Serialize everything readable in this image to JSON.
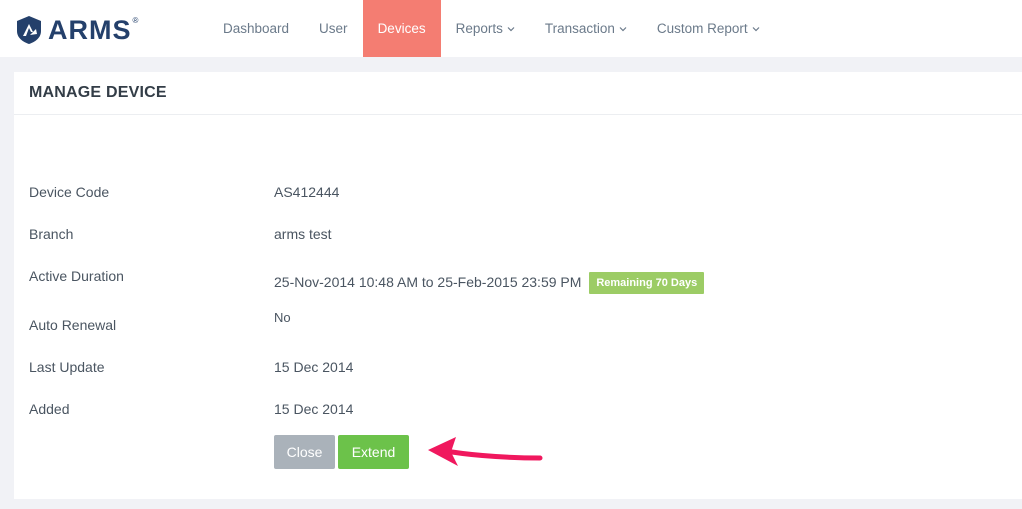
{
  "brand": {
    "name": "ARMS",
    "reg": "®"
  },
  "nav": [
    {
      "label": "Dashboard",
      "dropdown": false,
      "active": false
    },
    {
      "label": "User",
      "dropdown": false,
      "active": false
    },
    {
      "label": "Devices",
      "dropdown": false,
      "active": true
    },
    {
      "label": "Reports",
      "dropdown": true,
      "active": false
    },
    {
      "label": "Transaction",
      "dropdown": true,
      "active": false
    },
    {
      "label": "Custom Report",
      "dropdown": true,
      "active": false
    }
  ],
  "panel": {
    "title": "MANAGE DEVICE",
    "fields": {
      "device_code": {
        "label": "Device Code",
        "value": "AS412444"
      },
      "branch": {
        "label": "Branch",
        "value": "arms test"
      },
      "active_duration": {
        "label": "Active Duration",
        "value": "25-Nov-2014 10:48 AM to 25-Feb-2015 23:59 PM",
        "badge": "Remaining 70 Days"
      },
      "auto_renewal": {
        "label": "Auto Renewal",
        "value": "No"
      },
      "last_update": {
        "label": "Last Update",
        "value": "15 Dec 2014"
      },
      "added": {
        "label": "Added",
        "value": "15 Dec 2014"
      }
    },
    "buttons": {
      "close": "Close",
      "extend": "Extend"
    }
  },
  "colors": {
    "active_nav": "#f47d72",
    "brand": "#24406b",
    "badge": "#9ccc65",
    "extend": "#6cc24a",
    "close": "#aab2ba",
    "annotation_arrow": "#f0185e"
  }
}
